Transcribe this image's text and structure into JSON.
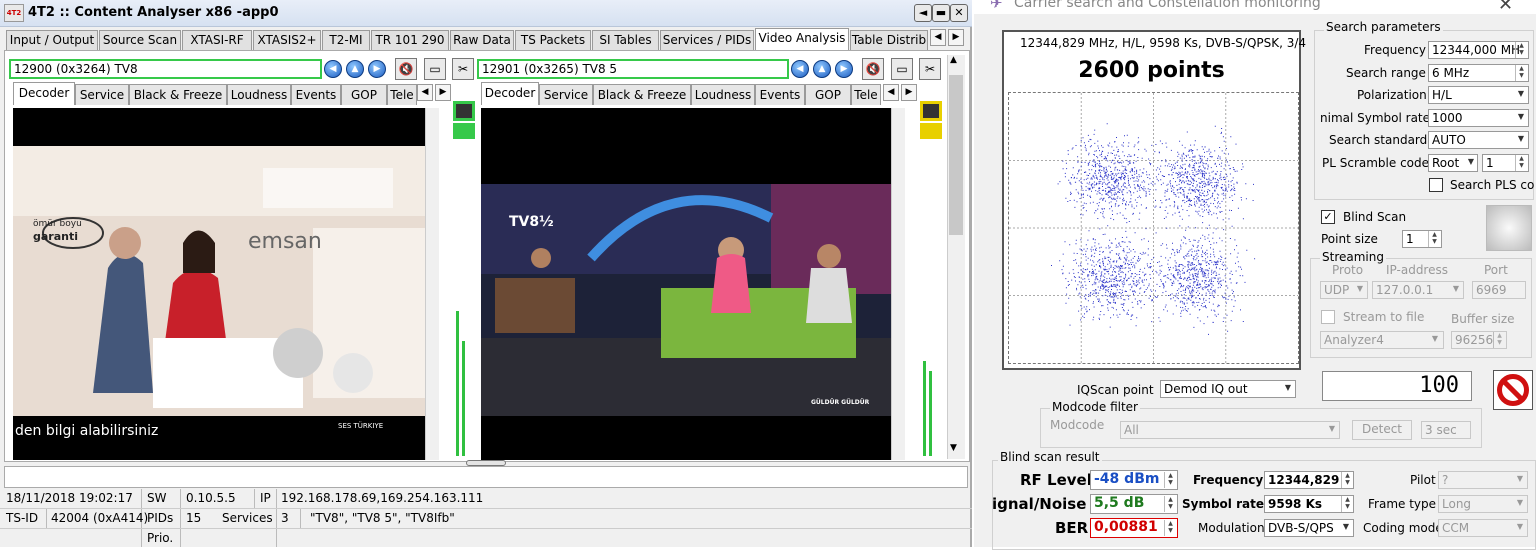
{
  "left_window": {
    "app_logo": "4T2",
    "title": "4T2 :: Content Analyser x86  -app0",
    "window_buttons": [
      "◄",
      "▬",
      "▭",
      "✕"
    ],
    "main_tabs": [
      "Input / Output",
      "Source Scan",
      "XTASI-RF",
      "XTASIS2+",
      "T2-MI",
      "TR 101 290",
      "Raw Data",
      "TS Packets",
      "SI Tables",
      "Services / PIDs",
      "Video Analysis",
      "Table Distrib"
    ],
    "active_main_tab": "Video Analysis",
    "panel1": {
      "service": "12900 (0x3264) TV8",
      "subtabs": [
        "Decoder",
        "Service",
        "Black & Freeze",
        "Loudness",
        "Events",
        "GOP",
        "Tele"
      ],
      "active_subtab": "Decoder",
      "overlay_text": "den bilgi alabilirsiniz",
      "ad_text_1": "ömür boyu",
      "ad_text_2": "garanti",
      "ad_store": "emsan",
      "ad_bottom": "SES TÜRKIYE"
    },
    "panel2": {
      "service": "12901 (0x3265) TV8 5",
      "subtabs": [
        "Decoder",
        "Service",
        "Black & Freeze",
        "Loudness",
        "Events",
        "GOP",
        "Tele"
      ],
      "active_subtab": "Decoder",
      "logo": "TV8½",
      "show_label": "GÜLDÜR GÜLDÜR"
    },
    "status": {
      "datetime": "18/11/2018 19:02:17",
      "sw_label": "SW",
      "sw_value": "0.10.5.5",
      "ip_label": "IP",
      "ip_value": "192.168.178.69,169.254.163.111",
      "tsid_label": "TS-ID",
      "tsid_value": "42004 (0xA414)",
      "pids_label": "PIDs",
      "pids_value": "15",
      "services_label": "Services",
      "services_value": "3",
      "services_list": "\"TV8\", \"TV8 5\", \"TV8Ifb\"",
      "prio_label": "Prio."
    }
  },
  "right_window": {
    "title": "Carrier search and Constellation monitoring",
    "constellation": {
      "info": "12344,829 MHz, H/L, 9598 Ks, DVB-S/QPSK, 3/4",
      "points_label": "2600 points",
      "point_count": 2600
    },
    "search_params": {
      "header": "Search parameters",
      "frequency_label": "Frequency",
      "frequency_value": "12344,000 MH",
      "range_label": "Search range",
      "range_value": "6 MHz",
      "polarization_label": "Polarization",
      "polarization_value": "H/L",
      "minsr_label": "nimal Symbol rate",
      "minsr_value": "1000",
      "standard_label": "Search standard",
      "standard_value": "AUTO",
      "pls_label": "PL Scramble code",
      "pls_mode": "Root",
      "pls_value": "1",
      "search_pls_label": "Search PLS co"
    },
    "blind_scan_label": "Blind Scan",
    "blind_scan_checked": true,
    "point_size_label": "Point size",
    "point_size_value": "1",
    "streaming": {
      "header": "Streaming",
      "proto_label": "Proto",
      "proto_value": "UDP",
      "ip_label": "IP-address",
      "ip_value": "127.0.0.1",
      "port_label": "Port",
      "port_value": "6969",
      "stream_file_label": "Stream to file",
      "buffer_label": "Buffer size",
      "file_value": "Analyzer4",
      "buffer_value": "96256"
    },
    "iqscan_label": "IQScan point",
    "iqscan_value": "Demod IQ out",
    "counter_display": "100",
    "modcode": {
      "header": "Modcode filter",
      "label": "Modcode",
      "value": "All",
      "detect_label": "Detect",
      "sec_value": "3 sec"
    },
    "blind_result": {
      "header": "Blind scan result",
      "rf_label": "RF Level",
      "rf_value": "-48 dBm",
      "snr_label": "ignal/Noise",
      "snr_value": "5,5 dB",
      "ber_label": "BER",
      "ber_value": "0,00881",
      "freq_label": "Frequency",
      "freq_value": "12344,829",
      "sr_label": "Symbol rate",
      "sr_value": "9598 Ks",
      "mod_label": "Modulation",
      "mod_value": "DVB-S/QPS",
      "pilot_label": "Pilot",
      "pilot_value": "?",
      "frame_label": "Frame type",
      "frame_value": "Long",
      "coding_label": "Coding mode",
      "coding_value": "CCM"
    },
    "colors": {
      "rf": "#1a4fc4",
      "snr": "#1f7a1f",
      "ber": "#d00000"
    }
  }
}
